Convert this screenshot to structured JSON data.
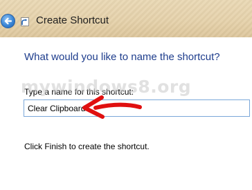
{
  "window": {
    "title": "Create Shortcut",
    "back_icon": "back-arrow-icon",
    "app_icon": "shortcut-icon"
  },
  "main": {
    "heading": "What would you like to name the shortcut?",
    "field_label": "Type a name for this shortcut:",
    "name_value": "Clear Clipboard",
    "finish_hint": "Click Finish to create the shortcut."
  },
  "overlay": {
    "watermark": "mywindows8.org",
    "arrow_icon": "red-arrow-annotation",
    "arrow_color": "#e01010"
  },
  "colors": {
    "heading": "#1d3c8c",
    "titlebar": "#e6d2ab",
    "input_border": "#7aa7d9"
  }
}
